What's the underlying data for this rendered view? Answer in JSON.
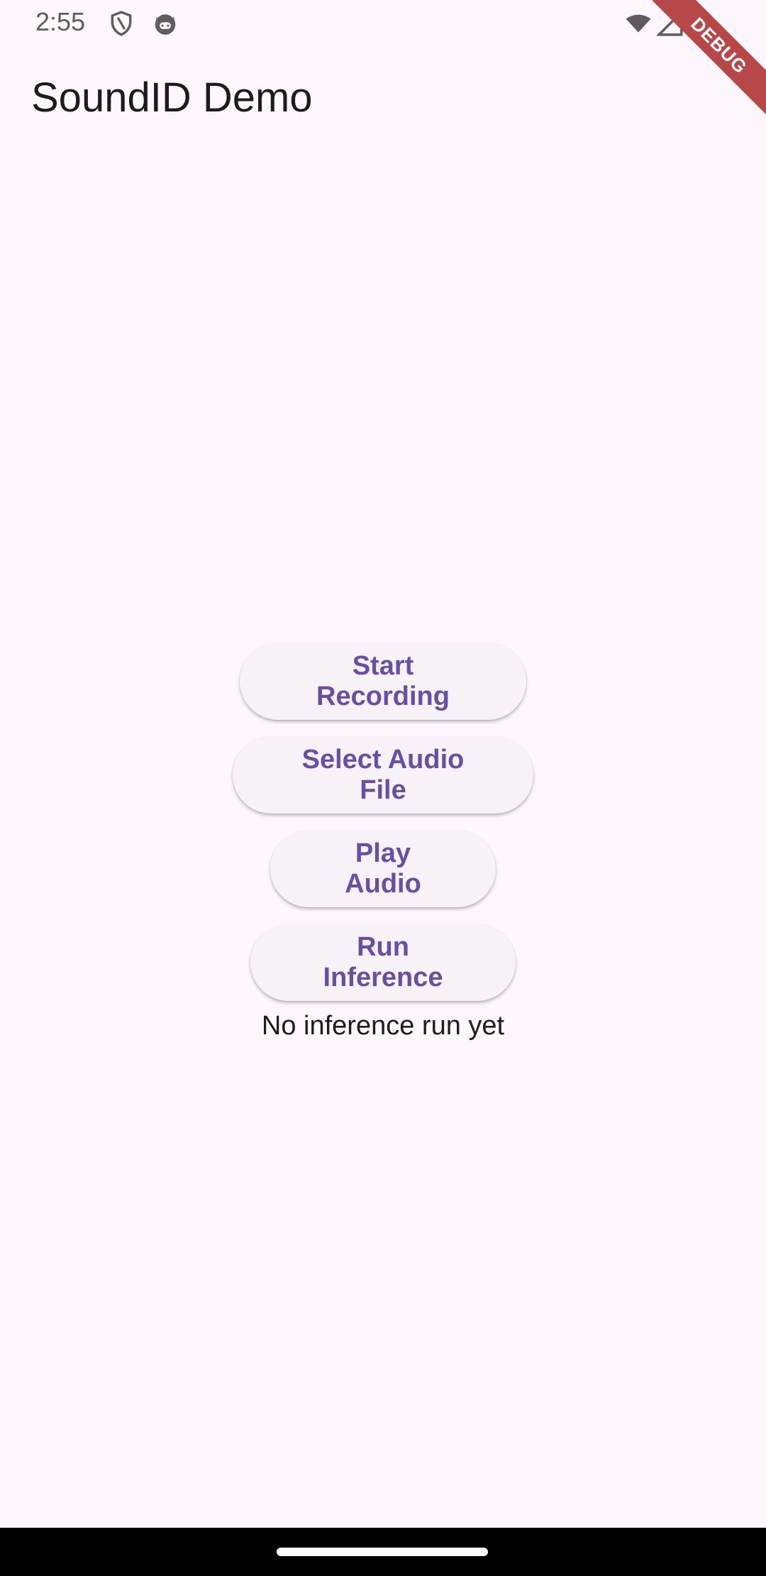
{
  "status_bar": {
    "time": "2:55",
    "icons": [
      "shield-icon",
      "cat-face-icon",
      "wifi-icon",
      "cellular-signal-icon",
      "battery-icon"
    ]
  },
  "app_bar": {
    "title": "SoundID Demo"
  },
  "buttons": {
    "start_recording": "Start Recording",
    "select_audio_file": "Select Audio File",
    "play_audio": "Play Audio",
    "run_inference": "Run Inference"
  },
  "inference_status": "No inference run yet",
  "debug_banner": "DEBUG",
  "colors": {
    "background": "#fdf7fd",
    "button_background": "#f7f2f7",
    "button_text": "#6750a4",
    "debug_banner": "#b8474a"
  }
}
